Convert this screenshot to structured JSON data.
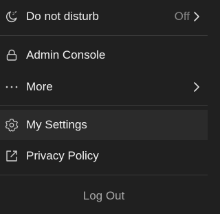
{
  "menu": {
    "do_not_disturb": {
      "label": "Do not disturb",
      "status": "Off",
      "icon": "moon-zzz-icon"
    },
    "admin_console": {
      "label": "Admin Console",
      "icon": "lock-icon"
    },
    "more": {
      "label": "More",
      "icon": "more-dots-icon"
    },
    "my_settings": {
      "label": "My Settings",
      "icon": "gear-icon"
    },
    "privacy_policy": {
      "label": "Privacy Policy",
      "icon": "external-link-icon"
    },
    "log_out": {
      "label": "Log Out"
    }
  },
  "colors": {
    "background": "#202020",
    "hover_row": "#2b2b2b",
    "divider": "#3a3a3a",
    "text": "#f2f2f2",
    "muted_text": "#8a8a8a",
    "logout_text": "#a8a8a8"
  }
}
